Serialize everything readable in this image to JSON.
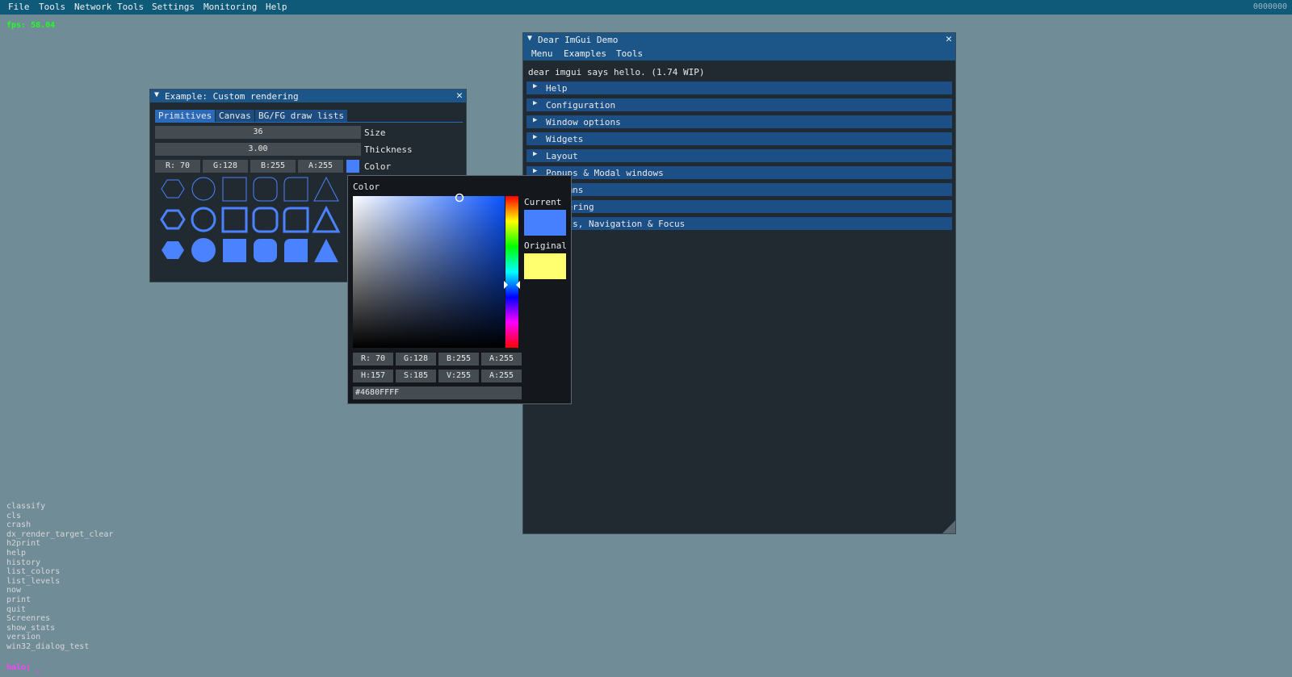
{
  "menubar": {
    "items": [
      "File",
      "Tools",
      "Network Tools",
      "Settings",
      "Monitoring",
      "Help"
    ],
    "right_text": "0000000"
  },
  "fps": "fps: 58.04",
  "custom_window": {
    "title": "Example: Custom rendering",
    "tabs": [
      "Primitives",
      "Canvas",
      "BG/FG draw lists"
    ],
    "size_value": "36",
    "size_label": "Size",
    "thickness_value": "3.00",
    "thickness_label": "Thickness",
    "rgba": [
      "R: 70",
      "G:128",
      "B:255",
      "A:255"
    ],
    "color_label": "Color",
    "swatch_color": "#4680ff"
  },
  "demo_window": {
    "title": "Dear ImGui Demo",
    "menu": [
      "Menu",
      "Examples",
      "Tools"
    ],
    "hello": "dear imgui says hello. (1.74 WIP)",
    "headers": [
      "Help",
      "Configuration",
      "Window options",
      "Widgets",
      "Layout",
      "Popups & Modal windows",
      "Columns",
      "Filtering",
      "Inputs, Navigation & Focus"
    ]
  },
  "color_popup": {
    "title": "Color",
    "current_label": "Current",
    "original_label": "Original",
    "current_color": "#4680ff",
    "original_color": "#ffff70",
    "rgba": [
      "R: 70",
      "G:128",
      "B:255",
      "A:255"
    ],
    "hsva": [
      "H:157",
      "S:185",
      "V:255",
      "A:255"
    ],
    "hex": "#4680FFFF"
  },
  "console": [
    "classify",
    "cls",
    "crash",
    "dx_render_target_clear",
    "h2print",
    "help",
    "history",
    "list_colors",
    "list_levels",
    "now",
    "print",
    "quit",
    "Screenres",
    "show_stats",
    "version",
    "win32_dialog_test"
  ],
  "prompt": "halo( _"
}
